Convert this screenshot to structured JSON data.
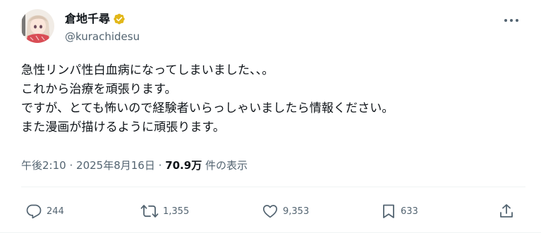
{
  "author": {
    "display_name": "倉地千尋",
    "handle": "@kurachidesu",
    "verified": true
  },
  "tweet": {
    "lines": [
      "急性リンパ性白血病になってしまいました、、。",
      "これから治療を頑張ります。",
      "ですが、とても怖いので経験者いらっしゃいましたら情報ください。",
      "また漫画が描けるように頑張ります。"
    ]
  },
  "meta": {
    "time": "午後2:10",
    "separator": "·",
    "date": "2025年8月16日",
    "views_count": "70.9万",
    "views_label": "件の表示"
  },
  "actions": {
    "replies": "244",
    "retweets": "1,355",
    "likes": "9,353",
    "bookmarks": "633"
  },
  "colors": {
    "text_primary": "#0f1419",
    "text_secondary": "#536471",
    "verified_badge": "#e2b719",
    "divider": "#eff3f4"
  },
  "icons": {
    "avatar": "avatar-illustration",
    "verified": "verified-badge-icon",
    "more": "more-dots-icon",
    "reply": "reply-icon",
    "retweet": "retweet-icon",
    "like": "heart-icon",
    "bookmark": "bookmark-icon",
    "share": "share-icon"
  }
}
